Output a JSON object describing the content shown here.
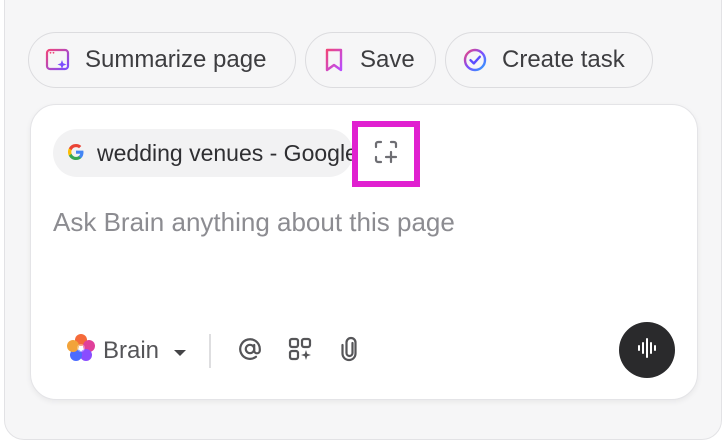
{
  "actions": {
    "summarize_label": "Summarize page",
    "save_label": "Save",
    "create_task_label": "Create task"
  },
  "composer": {
    "context_chip_text": "wedding venues - Google Search",
    "placeholder": "Ask Brain anything about this page",
    "model_label": "Brain"
  },
  "icons": {
    "summarize": "browser-sparkle-icon",
    "save": "bookmark-icon",
    "create_task": "check-circle-icon",
    "context_source": "google-g-icon",
    "select_area": "screen-select-plus-icon",
    "model": "brain-logo-icon",
    "model_dropdown": "caret-down-icon",
    "mention": "at-sign-icon",
    "apps": "apps-sparkle-icon",
    "attach": "paperclip-icon",
    "voice": "voice-waveform-icon"
  },
  "colors": {
    "highlight": "#e020d0",
    "voice_button": "#2a2a2c",
    "placeholder_text": "#8c8c91"
  }
}
